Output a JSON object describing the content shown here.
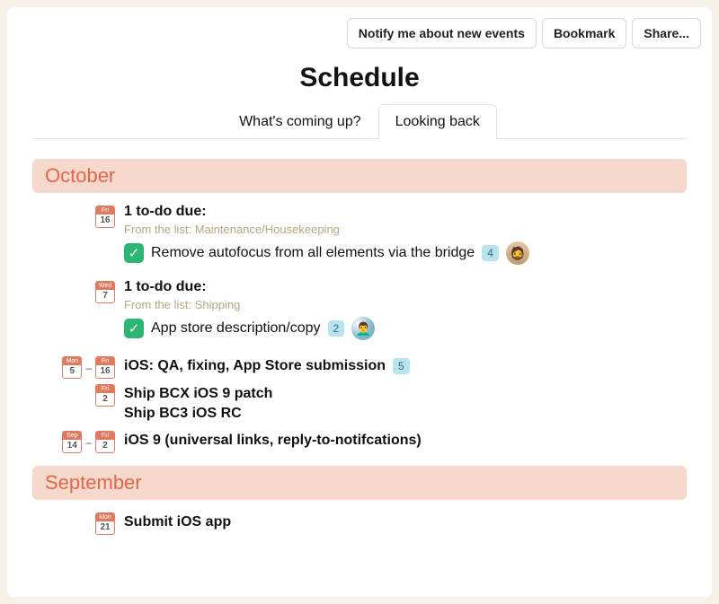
{
  "actions": {
    "notify": "Notify me about new events",
    "bookmark": "Bookmark",
    "share": "Share..."
  },
  "title": "Schedule",
  "tabs": {
    "upcoming": "What's coming up?",
    "past": "Looking back"
  },
  "months": {
    "oct": "October",
    "sep": "September"
  },
  "oct": {
    "d16": {
      "dow": "Fri",
      "num": "16",
      "heading": "1 to-do due:",
      "from": "From the list: Maintenance/Housekeeping",
      "todo": "Remove autofocus from all elements via the bridge",
      "comments": "4"
    },
    "d7": {
      "dow": "Wed",
      "num": "7",
      "heading": "1 to-do due:",
      "from": "From the list: Shipping",
      "todo": "App store description/copy",
      "comments": "2"
    },
    "range1": {
      "a_dow": "Mon",
      "a_num": "5",
      "b_dow": "Fri",
      "b_num": "16",
      "title": "iOS: QA, fixing, App Store submission",
      "comments": "5"
    },
    "d2": {
      "dow": "Fri",
      "num": "2",
      "title1": "Ship BCX iOS 9 patch",
      "title2": "Ship BC3 iOS RC"
    },
    "range2": {
      "a_dow": "Sep",
      "a_num": "14",
      "b_dow": "Fri",
      "b_num": "2",
      "title": "iOS 9 (universal links, reply-to-notifcations)"
    }
  },
  "sep": {
    "d21": {
      "dow": "Mon",
      "num": "21",
      "title": "Submit iOS app"
    }
  }
}
